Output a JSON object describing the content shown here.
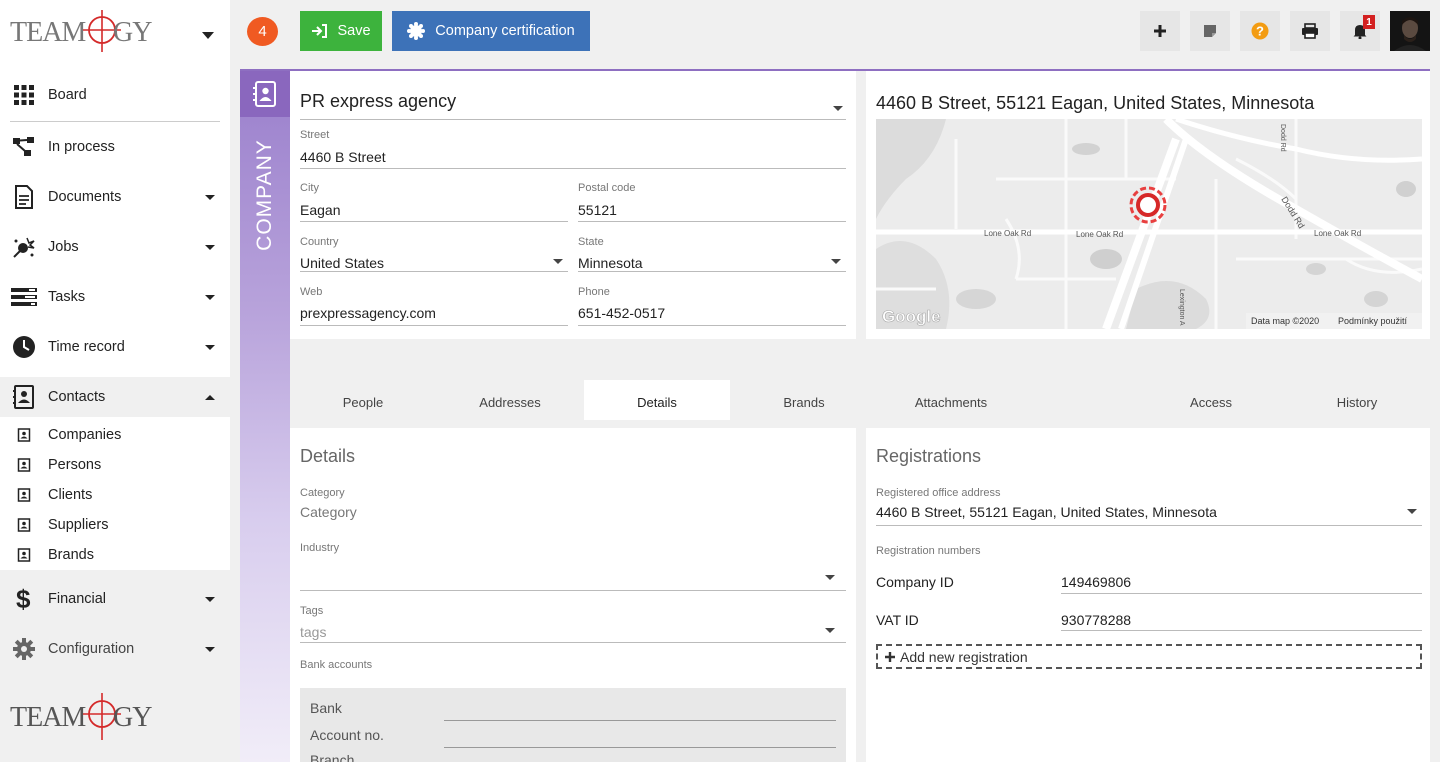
{
  "app": {
    "logo_text": "TEAMOGY"
  },
  "sidebar": {
    "items": [
      {
        "label": "Board",
        "icon": "grid-icon"
      },
      {
        "label": "In process",
        "icon": "flow-icon"
      },
      {
        "label": "Documents",
        "icon": "document-icon"
      },
      {
        "label": "Jobs",
        "icon": "jobs-icon"
      },
      {
        "label": "Tasks",
        "icon": "tasks-icon"
      },
      {
        "label": "Time record",
        "icon": "clock-icon"
      },
      {
        "label": "Contacts",
        "icon": "contacts-icon"
      },
      {
        "label": "Financial",
        "icon": "dollar-icon"
      },
      {
        "label": "Configuration",
        "icon": "gear-icon"
      }
    ],
    "contacts_sub": [
      {
        "label": "Companies"
      },
      {
        "label": "Persons"
      },
      {
        "label": "Clients"
      },
      {
        "label": "Suppliers"
      },
      {
        "label": "Brands"
      }
    ]
  },
  "topbar": {
    "badge_count": "4",
    "save_label": "Save",
    "cert_label": "Company certification",
    "notification_count": "1"
  },
  "company": {
    "band_label": "COMPANY",
    "name": "PR express agency",
    "street_label": "Street",
    "street": "4460  B Street",
    "city_label": "City",
    "city": "Eagan",
    "postal_label": "Postal code",
    "postal": "55121",
    "country_label": "Country",
    "country": "United States",
    "state_label": "State",
    "state": "Minnesota",
    "web_label": "Web",
    "web": "prexpressagency.com",
    "phone_label": "Phone",
    "phone": "651-452-0517"
  },
  "map": {
    "title": "4460 B Street, 55121 Eagan, United States, Minnesota",
    "labels": {
      "lone_oak_1": "Lone Oak Rd",
      "lone_oak_2": "Lone Oak Rd",
      "lone_oak_3": "Lone Oak Rd",
      "dodd_rd": "Dodd Rd",
      "dodd_rd_top": "Dodd Rd",
      "lexington": "Lexington A",
      "google": "Google",
      "data": "Data map ©2020",
      "terms": "Podmínky použití"
    }
  },
  "tabs": [
    {
      "label": "People"
    },
    {
      "label": "Addresses"
    },
    {
      "label": "Details"
    },
    {
      "label": "Brands"
    },
    {
      "label": "Attachments"
    },
    {
      "label": "Access"
    },
    {
      "label": "History"
    }
  ],
  "details": {
    "title": "Details",
    "category_label": "Category",
    "category_value": "Category",
    "industry_label": "Industry",
    "tags_label": "Tags",
    "tags_placeholder": "tags",
    "bank_accounts_label": "Bank accounts",
    "bank_label": "Bank",
    "account_label": "Account no.",
    "next_label": "Branch"
  },
  "registrations": {
    "title": "Registrations",
    "office_label": "Registered office address",
    "office_value": "4460 B Street, 55121 Eagan, United States, Minnesota",
    "numbers_label": "Registration numbers",
    "company_id_label": "Company ID",
    "company_id": "149469806",
    "vat_id_label": "VAT ID",
    "vat_id": "930778288",
    "add_label": "Add new registration"
  }
}
